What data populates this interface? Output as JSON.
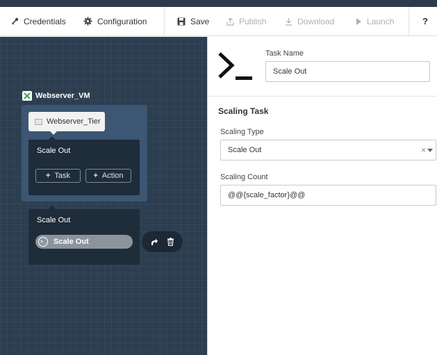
{
  "toolbar": {
    "credentials": "Credentials",
    "configuration": "Configuration",
    "save": "Save",
    "publish": "Publish",
    "download": "Download",
    "launch": "Launch",
    "help": "?"
  },
  "canvas": {
    "vm_title": "Webserver_VM",
    "tier_label": "Webserver_Tier",
    "inner_box_title": "Scale Out",
    "add_task_label": "Task",
    "add_action_label": "Action",
    "action_box_title": "Scale Out",
    "task_pill_label": "Scale Out",
    "task_pill_icon_glyph": ">_"
  },
  "panel": {
    "task_name_label": "Task Name",
    "task_name_value": "Scale Out",
    "section_title": "Scaling Task",
    "scaling_type_label": "Scaling Type",
    "scaling_type_value": "Scale Out",
    "scaling_type_clear": "×",
    "scaling_count_label": "Scaling Count",
    "scaling_count_value": "@@{scale_factor}@@"
  },
  "colors": {
    "canvas_bg": "#2c3e50",
    "vm_card_bg": "#3c5673",
    "dark_box": "#1f2c3a",
    "accent_green": "#3fae49"
  }
}
